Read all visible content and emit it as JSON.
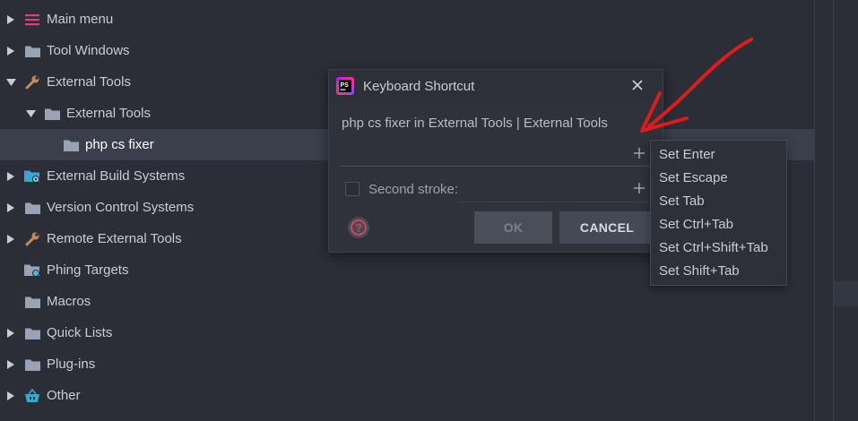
{
  "tree": {
    "items": [
      {
        "label": "Main menu",
        "icon": "menu-icon",
        "expanded": false
      },
      {
        "label": "Tool Windows",
        "icon": "folder-icon",
        "expanded": false
      },
      {
        "label": "External Tools",
        "icon": "wrench-icon",
        "expanded": true
      },
      {
        "label": "External Tools",
        "icon": "folder-icon",
        "expanded": true
      },
      {
        "label": "php cs fixer",
        "icon": "folder-icon",
        "selected": true
      },
      {
        "label": "External Build Systems",
        "icon": "build-folder-icon",
        "expanded": false
      },
      {
        "label": "Version Control Systems",
        "icon": "folder-icon",
        "expanded": false
      },
      {
        "label": "Remote External Tools",
        "icon": "wrench-icon",
        "expanded": false
      },
      {
        "label": "Phing Targets",
        "icon": "phing-folder-icon"
      },
      {
        "label": "Macros",
        "icon": "folder-icon"
      },
      {
        "label": "Quick Lists",
        "icon": "folder-icon",
        "expanded": false
      },
      {
        "label": "Plug-ins",
        "icon": "folder-icon",
        "expanded": false
      },
      {
        "label": "Other",
        "icon": "basket-icon",
        "expanded": false
      }
    ]
  },
  "dialog": {
    "title": "Keyboard Shortcut",
    "app_icon": "phpstorm-icon",
    "description": "php cs fixer in External Tools | External Tools",
    "first_stroke_value": "",
    "second_stroke_label": "Second stroke:",
    "second_stroke_checked": false,
    "ok_label": "OK",
    "cancel_label": "CANCEL"
  },
  "shortcut_menu": {
    "items": [
      "Set Enter",
      "Set Escape",
      "Set Tab",
      "Set Ctrl+Tab",
      "Set Ctrl+Shift+Tab",
      "Set Shift+Tab"
    ]
  },
  "colors": {
    "background": "#2b2e37",
    "selection": "#3a3f4b",
    "folder": "#9aa3b3",
    "menu_icon": "#e0407a",
    "annotation_arrow": "#e01b1b"
  }
}
